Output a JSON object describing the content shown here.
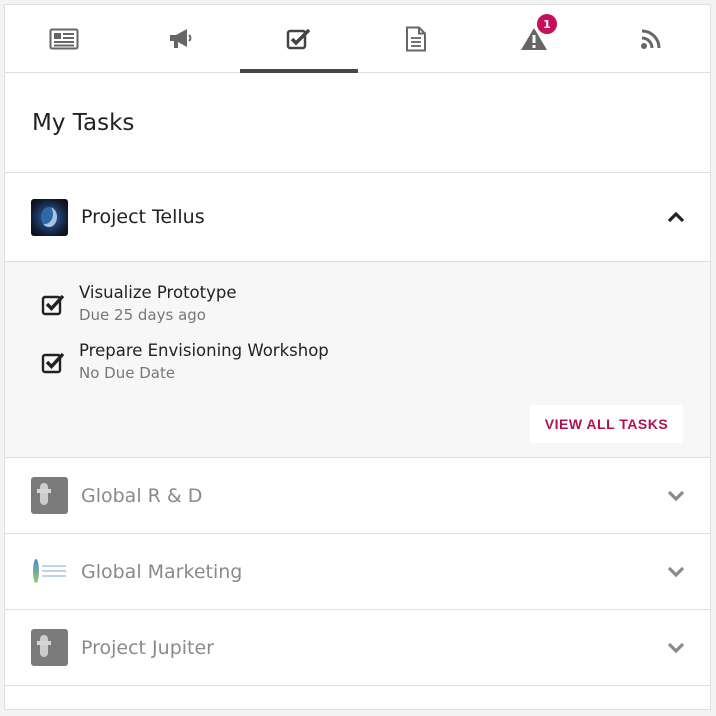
{
  "tabs": [
    {
      "icon": "newspaper-icon"
    },
    {
      "icon": "megaphone-icon"
    },
    {
      "icon": "task-check-icon",
      "active": true
    },
    {
      "icon": "document-icon"
    },
    {
      "icon": "warning-icon",
      "badge": "1"
    },
    {
      "icon": "rss-icon"
    }
  ],
  "header": {
    "title": "My Tasks"
  },
  "projects": [
    {
      "name": "Project Tellus",
      "expanded": true,
      "tasks": [
        {
          "name": "Visualize Prototype",
          "due": "Due 25 days ago",
          "checked": true
        },
        {
          "name": "Prepare Envisioning Workshop",
          "due": "No Due Date",
          "checked": true
        }
      ],
      "view_all_label": "VIEW ALL TASKS"
    },
    {
      "name": "Global R & D",
      "expanded": false
    },
    {
      "name": "Global Marketing",
      "expanded": false
    },
    {
      "name": "Project Jupiter",
      "expanded": false
    }
  ],
  "colors": {
    "accent": "#b0124f",
    "badge": "#c4105a",
    "active_tab_bar": "#474747"
  }
}
